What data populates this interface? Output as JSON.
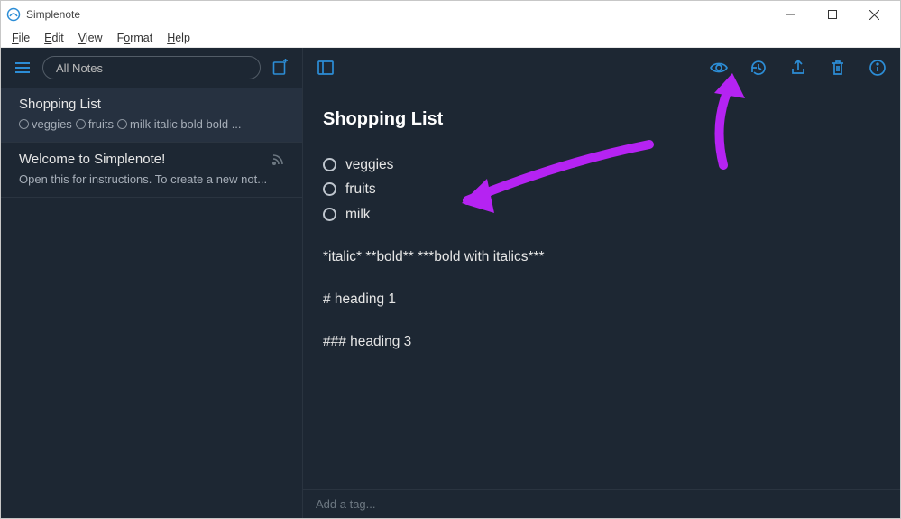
{
  "window": {
    "app_title": "Simplenote"
  },
  "menubar": {
    "file": "File",
    "edit": "Edit",
    "view": "View",
    "format": "Format",
    "help": "Help"
  },
  "sidebar": {
    "search_placeholder": "All Notes",
    "notes": [
      {
        "title": "Shopping List",
        "preview_items": [
          "veggies",
          "fruits",
          "milk italic bold bold ..."
        ]
      },
      {
        "title": "Welcome to Simplenote!",
        "preview": "Open this for instructions. To create a new not..."
      }
    ]
  },
  "editor": {
    "title": "Shopping List",
    "checklist": [
      "veggies",
      "fruits",
      "milk"
    ],
    "line_format": "*italic*   **bold**   ***bold with italics***",
    "line_h1": "# heading 1",
    "line_h3": "### heading 3",
    "tag_placeholder": "Add a tag..."
  },
  "colors": {
    "accent": "#2c8dd6",
    "bg_dark": "#1d2733",
    "arrow": "#b523f2"
  }
}
